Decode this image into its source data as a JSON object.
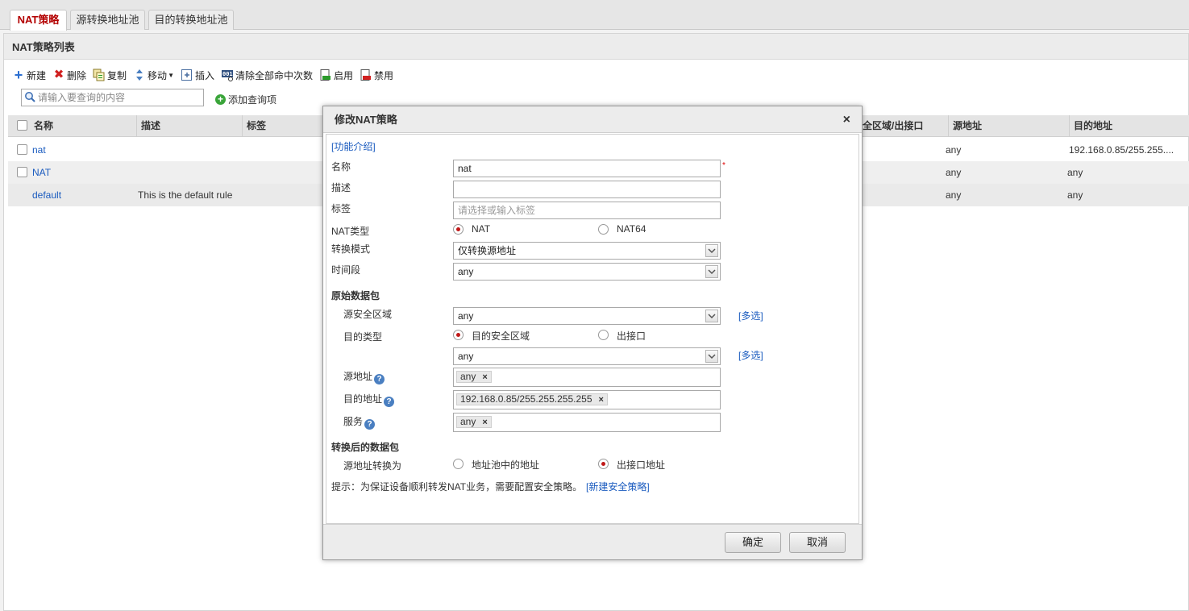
{
  "tabs": [
    "NAT策略",
    "源转换地址池",
    "目的转换地址池"
  ],
  "panel_title": "NAT策略列表",
  "toolbar": [
    "新建",
    "删除",
    "复制",
    "移动",
    "插入",
    "清除全部命中次数",
    "启用",
    "禁用"
  ],
  "search": {
    "placeholder": "请输入要查询的内容",
    "add_query": "添加查询项"
  },
  "table": {
    "headers": [
      "名称",
      "描述",
      "标签",
      "全区域/出接口",
      "源地址",
      "目的地址"
    ],
    "rows": [
      {
        "name": "nat",
        "desc": "",
        "src": "any",
        "dst": "192.168.0.85/255.255...."
      },
      {
        "name": "NAT",
        "desc": "",
        "src": "any",
        "dst": "any"
      },
      {
        "name": "default",
        "desc": "This is the default rule",
        "src": "any",
        "dst": "any"
      }
    ]
  },
  "modal": {
    "title": "修改NAT策略",
    "close": "×",
    "intro_link": "[功能介绍]",
    "labels": {
      "name": "名称",
      "desc": "描述",
      "tag": "标签",
      "nat_type": "NAT类型",
      "mode": "转换模式",
      "time": "时间段",
      "orig_section": "原始数据包",
      "src_zone": "源安全区域",
      "dst_type": "目的类型",
      "src_addr": "源地址",
      "dst_addr": "目的地址",
      "service": "服务",
      "trans_section": "转换后的数据包",
      "src_trans": "源地址转换为"
    },
    "values": {
      "name": "nat",
      "desc": "",
      "tag_placeholder": "请选择或输入标签",
      "nat_opt1": "NAT",
      "nat_opt2": "NAT64",
      "mode": "仅转换源地址",
      "time": "any",
      "src_zone": "any",
      "dst_type_opt1": "目的安全区域",
      "dst_type_opt2": "出接口",
      "dst_zone": "any",
      "multi": "[多选]",
      "src_addr_tag": "any",
      "dst_addr_tag": "192.168.0.85/255.255.255.255",
      "service_tag": "any",
      "trans_opt1": "地址池中的地址",
      "trans_opt2": "出接口地址"
    },
    "hint": "提示：为保证设备顺利转发NAT业务，需要配置安全策略。",
    "hint_link": "[新建安全策略]",
    "ok": "确定",
    "cancel": "取消"
  }
}
